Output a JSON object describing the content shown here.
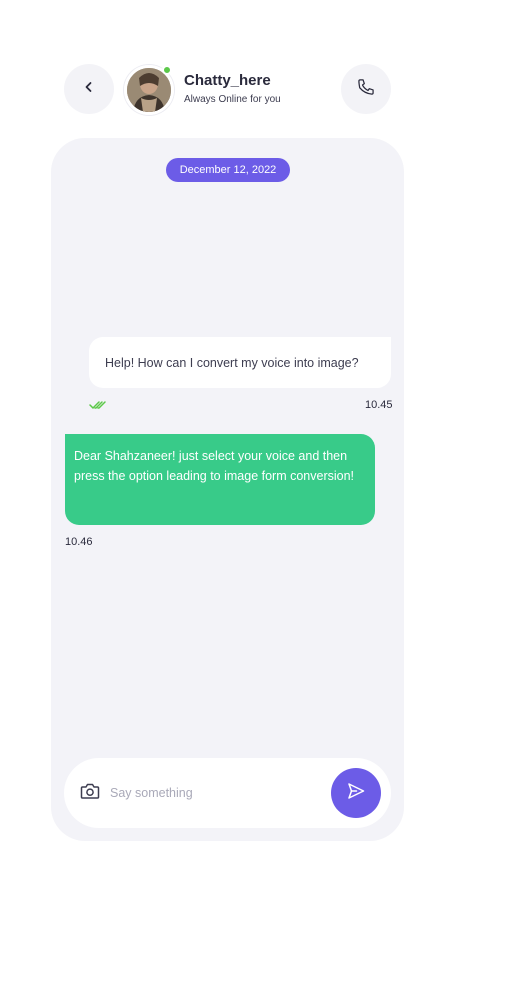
{
  "header": {
    "back_icon": "chevron-left-icon",
    "contact_name": "Chatty_here",
    "contact_status": "Always Online for you",
    "online_color": "#5cc84a",
    "call_icon": "phone-icon"
  },
  "chat": {
    "date_label": "December 12, 2022",
    "messages": [
      {
        "direction": "outgoing",
        "text": "Help! How can I convert my voice into image?",
        "time": "10.45",
        "status_icon": "double-check-icon"
      },
      {
        "direction": "incoming",
        "text": "Dear Shahzaneer! just select your voice and then press the option leading to image form conversion!",
        "time": "10.46"
      }
    ]
  },
  "composer": {
    "camera_icon": "camera-icon",
    "value": "",
    "placeholder": "Say something",
    "send_icon": "send-icon"
  },
  "colors": {
    "accent": "#6c5ce7",
    "incoming_bubble": "#38cb89",
    "panel_background": "#f3f3f8"
  }
}
